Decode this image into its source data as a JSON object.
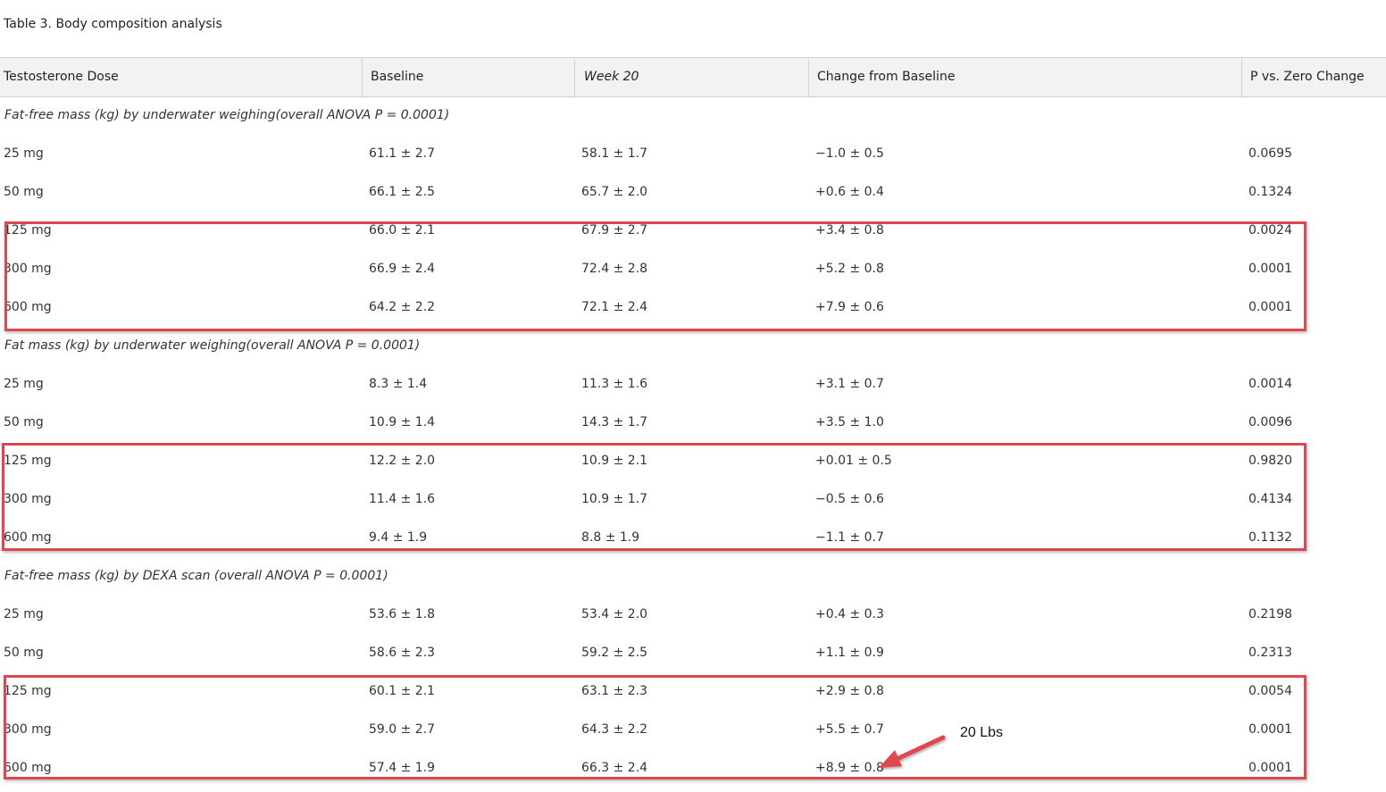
{
  "caption": "Table 3. Body composition analysis",
  "headers": [
    "Testosterone Dose",
    "Baseline",
    "Week 20",
    "Change from Baseline",
    "P vs. Zero Change"
  ],
  "sections": [
    {
      "title": "Fat-free mass (kg) by underwater weighing(overall ANOVA P = 0.0001)",
      "rows": [
        [
          "25 mg",
          "61.1 ± 2.7",
          "58.1 ± 1.7",
          "−1.0 ± 0.5",
          "0.0695"
        ],
        [
          "50 mg",
          "66.1 ± 2.5",
          "65.7 ± 2.0",
          "+0.6 ± 0.4",
          "0.1324"
        ],
        [
          "125 mg",
          "66.0 ± 2.1",
          "67.9 ± 2.7",
          "+3.4 ± 0.8",
          "0.0024"
        ],
        [
          "300 mg",
          "66.9 ± 2.4",
          "72.4 ± 2.8",
          "+5.2 ± 0.8",
          "0.0001"
        ],
        [
          "600 mg",
          "64.2 ± 2.2",
          "72.1 ± 2.4",
          "+7.9 ± 0.6",
          "0.0001"
        ]
      ]
    },
    {
      "title": "Fat mass (kg) by underwater weighing(overall ANOVA P = 0.0001)",
      "rows": [
        [
          "25 mg",
          "8.3 ± 1.4",
          "11.3 ± 1.6",
          "+3.1 ± 0.7",
          "0.0014"
        ],
        [
          "50 mg",
          "10.9 ± 1.4",
          "14.3 ± 1.7",
          "+3.5 ± 1.0",
          "0.0096"
        ],
        [
          "125 mg",
          "12.2 ± 2.0",
          "10.9 ± 2.1",
          "+0.01 ± 0.5",
          "0.9820"
        ],
        [
          "300 mg",
          "11.4 ± 1.6",
          "10.9 ± 1.7",
          "−0.5 ± 0.6",
          "0.4134"
        ],
        [
          "600 mg",
          "9.4 ± 1.9",
          "8.8 ± 1.9",
          "−1.1 ± 0.7",
          "0.1132"
        ]
      ]
    },
    {
      "title": "Fat-free mass (kg) by DEXA scan (overall ANOVA P = 0.0001)",
      "rows": [
        [
          "25 mg",
          "53.6 ± 1.8",
          "53.4 ± 2.0",
          "+0.4 ± 0.3",
          "0.2198"
        ],
        [
          "50 mg",
          "58.6 ± 2.3",
          "59.2 ± 2.5",
          "+1.1 ± 0.9",
          "0.2313"
        ],
        [
          "125 mg",
          "60.1 ± 2.1",
          "63.1 ± 2.3",
          "+2.9 ± 0.8",
          "0.0054"
        ],
        [
          "300 mg",
          "59.0 ± 2.7",
          "64.3 ± 2.2",
          "+5.5 ± 0.7",
          "0.0001"
        ],
        [
          "600 mg",
          "57.4 ± 1.9",
          "66.3 ± 2.4",
          "+8.9 ± 0.8",
          "0.0001"
        ]
      ]
    }
  ],
  "annotation": {
    "label": "20 Lbs",
    "color": "#e0464f"
  }
}
